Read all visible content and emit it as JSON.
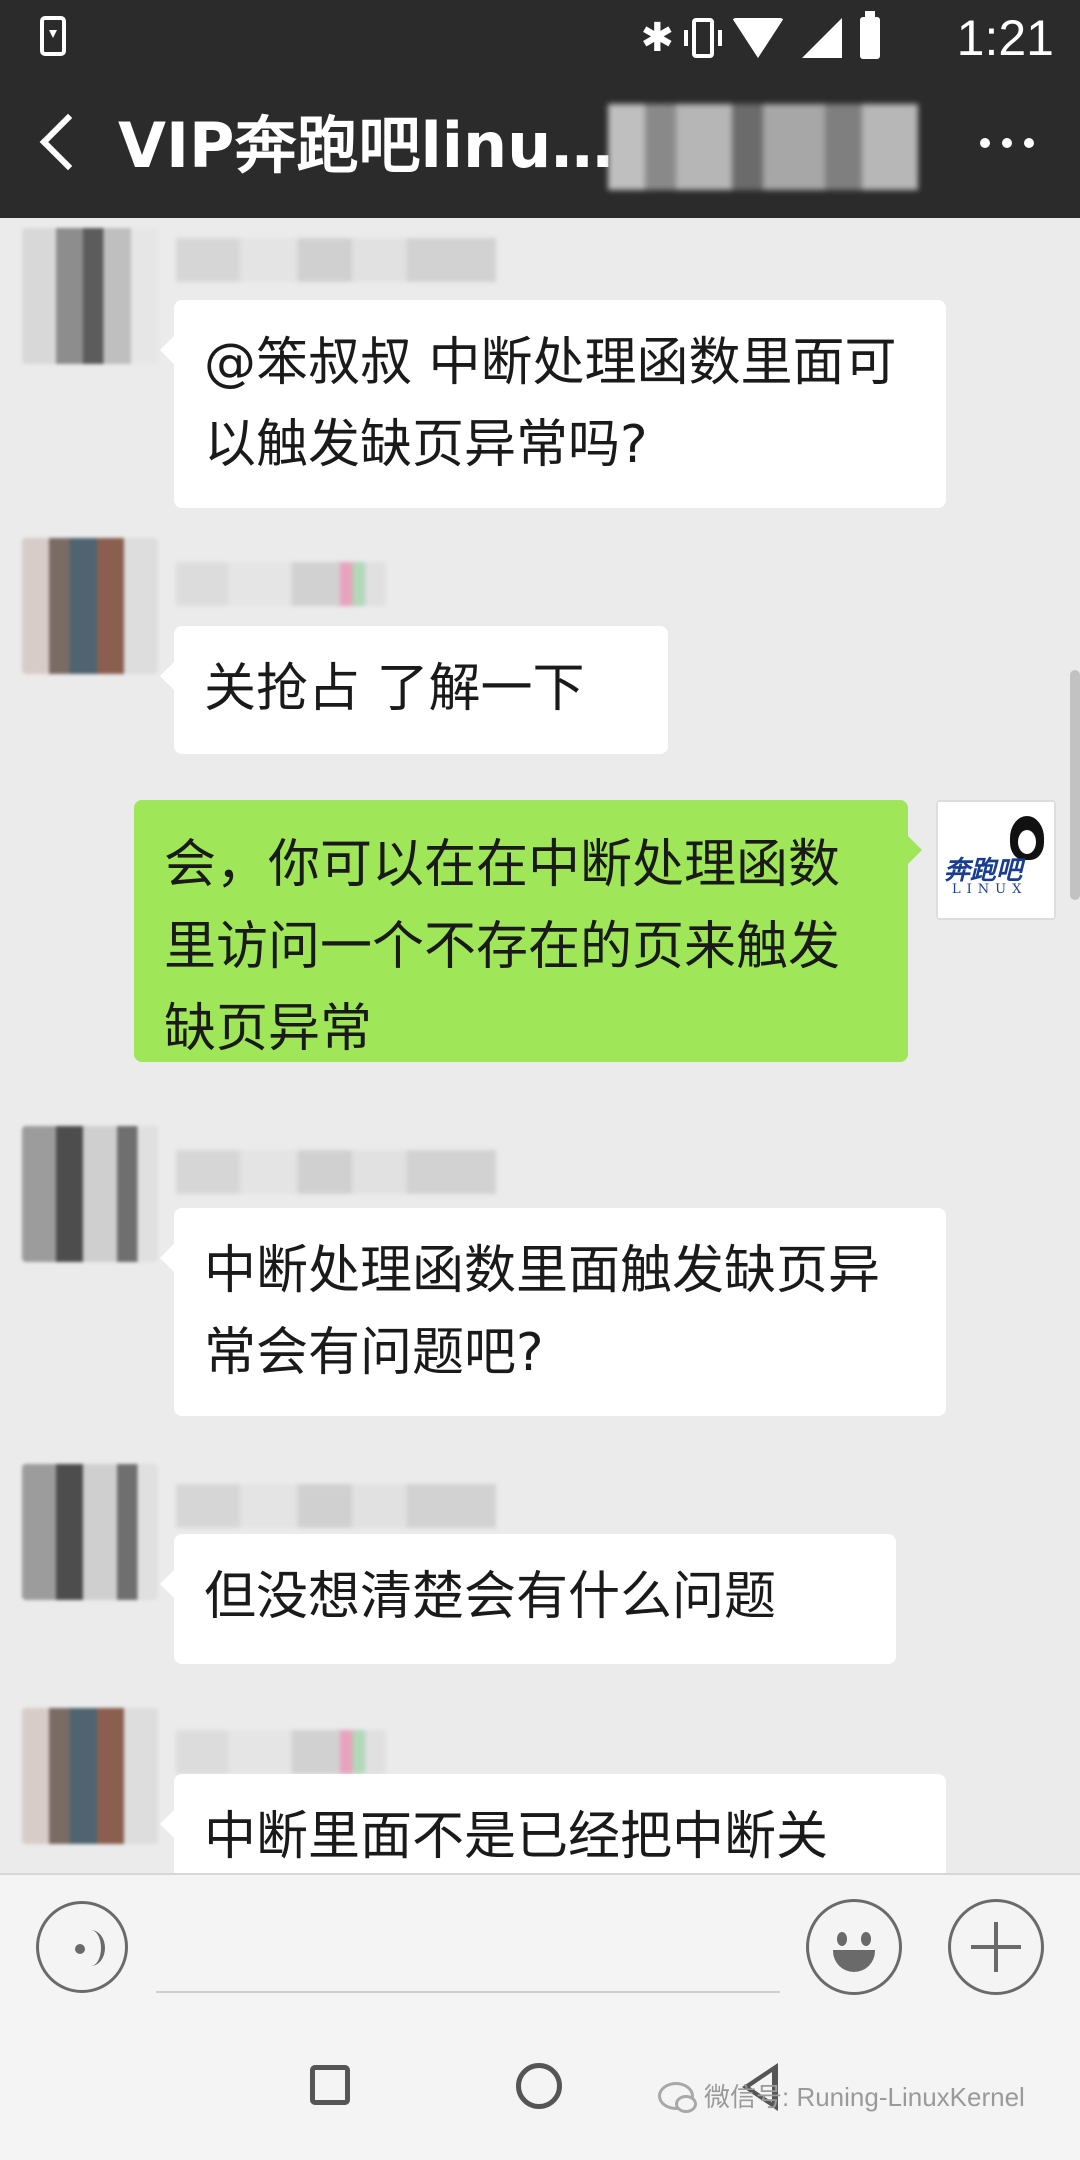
{
  "status_bar": {
    "time": "1:21"
  },
  "header": {
    "title": "VIP奔跑吧linu…"
  },
  "messages": [
    {
      "side": "left",
      "text": "@笨叔叔  中断处理函数里面可以触发缺页异常吗?"
    },
    {
      "side": "left",
      "text": "关抢占 了解一下"
    },
    {
      "side": "right",
      "text": "会，你可以在在中断处理函数里访问一个不存在的页来触发 缺页异常"
    },
    {
      "side": "left",
      "text": "中断处理函数里面触发缺页异常会有问题吧?"
    },
    {
      "side": "left",
      "text": "但没想清楚会有什么问题"
    },
    {
      "side": "left",
      "text": "中断里面不是已经把中断关"
    }
  ],
  "self_avatar": {
    "logo_text": "奔跑吧",
    "logo_sub": "LINUX"
  },
  "watermark": {
    "text": "微信号: Runing-LinuxKernel"
  },
  "icons": {
    "back": "back-arrow-icon",
    "more": "more-dots-icon",
    "voice": "voice-icon",
    "emoji": "emoji-icon",
    "plus": "plus-icon"
  },
  "colors": {
    "header_bg": "#2b2b2b",
    "chat_bg": "#ebebeb",
    "self_bubble": "#9fe658",
    "other_bubble": "#ffffff"
  }
}
